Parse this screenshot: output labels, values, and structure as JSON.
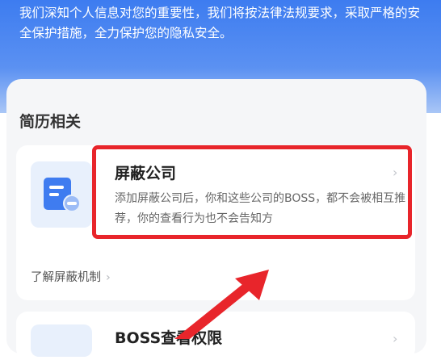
{
  "header": {
    "intro_text": "我们深知个人信息对您的重要性，我们将按法律法规要求，采取严格的安全保护措施，全力保护您的隐私安全。"
  },
  "section": {
    "title": "简历相关"
  },
  "block_company": {
    "icon": "document-icon",
    "title": "屏蔽公司",
    "chevron": "›",
    "description": "添加屏蔽公司后，你和这些公司的BOSS，都不会被相互推荐，你的查看行为也不会告知方",
    "learn_more": "了解屏蔽机制",
    "learn_more_chevron": "›"
  },
  "next_item": {
    "title": "BOSS查看权限",
    "chevron": "›"
  },
  "annotation": {
    "highlight_color": "#e8252b"
  }
}
